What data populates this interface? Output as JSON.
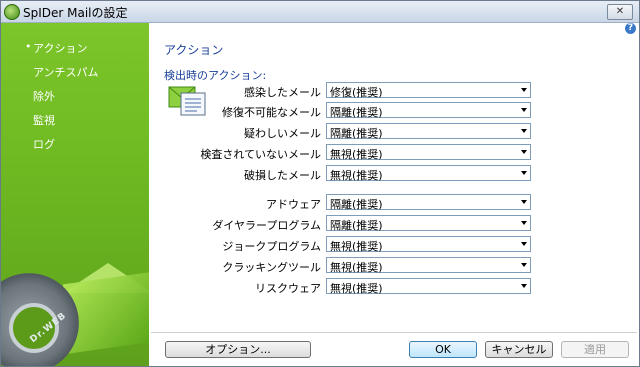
{
  "window": {
    "title": "SpIDer Mailの設定",
    "close_label": "✕",
    "help_label": "?"
  },
  "sidebar": {
    "items": [
      {
        "label": "アクション",
        "active": true
      },
      {
        "label": "アンチスパム"
      },
      {
        "label": "除外"
      },
      {
        "label": "監視"
      },
      {
        "label": "ログ"
      }
    ],
    "bullet": "•",
    "logo_text": "Dr.WEB"
  },
  "main": {
    "title": "アクション",
    "section_label": "検出時のアクション:",
    "rows": [
      {
        "label": "感染したメール",
        "value": "修復(推奨)"
      },
      {
        "label": "修復不可能なメール",
        "value": "隔離(推奨)"
      },
      {
        "label": "疑わしいメール",
        "value": "隔離(推奨)"
      },
      {
        "label": "検査されていないメール",
        "value": "無視(推奨)"
      },
      {
        "label": "破損したメール",
        "value": "無視(推奨)"
      },
      {
        "label": "アドウェア",
        "value": "隔離(推奨)"
      },
      {
        "label": "ダイヤラープログラム",
        "value": "隔離(推奨)"
      },
      {
        "label": "ジョークプログラム",
        "value": "無視(推奨)"
      },
      {
        "label": "クラッキングツール",
        "value": "無視(推奨)"
      },
      {
        "label": "リスクウェア",
        "value": "無視(推奨)"
      }
    ]
  },
  "buttons": {
    "options": "オプション...",
    "ok": "OK",
    "cancel": "キャンセル",
    "apply": "適用"
  },
  "colors": {
    "sidebar_green": "#6ab420",
    "heading_blue": "#1a3f9a"
  }
}
